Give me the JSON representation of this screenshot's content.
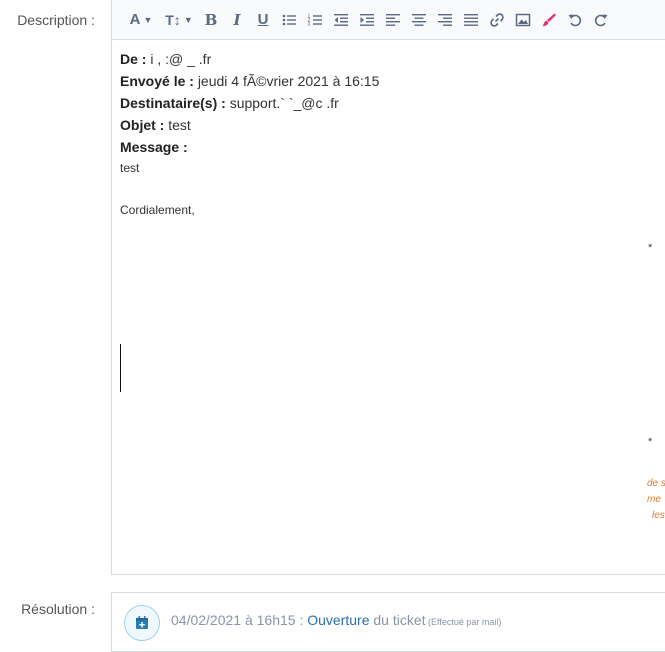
{
  "labels": {
    "description": "Description :",
    "resolution": "Résolution :"
  },
  "editor": {
    "lines": {
      "de_label": "De :",
      "de_value": "i              ,  :@     _    .fr",
      "envoye_label": "Envoyé le :",
      "envoye_value": "jeudi 4 fÃ©vrier 2021 à 16:15",
      "dest_label": "Destinataire(s) :",
      "dest_value": "support.`  `_@c          .fr",
      "objet_label": "Objet :",
      "objet_value": "test",
      "message_label": "Message :",
      "body_1": "test",
      "body_2": "Cordialement,"
    },
    "stars": [
      "*",
      "*"
    ],
    "orange_snippets": [
      "de s",
      "me",
      "les"
    ]
  },
  "resolution": {
    "date": "04/02/2021 à 16h15",
    "sep": " : ",
    "link": "Ouverture",
    "rest": " du ticket",
    "note": " (Effectué par mail)"
  },
  "colors": {
    "accent": "#2a6fb0",
    "orange": "#e07a2c",
    "brush": "#e0337a"
  }
}
